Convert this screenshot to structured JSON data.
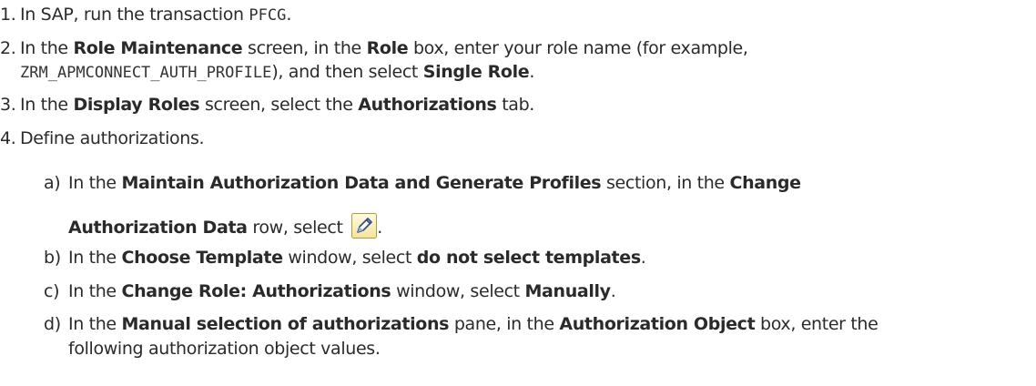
{
  "steps": [
    {
      "num": "1.",
      "parts": [
        {
          "t": "text",
          "v": "In SAP, run the transaction "
        },
        {
          "t": "code",
          "v": "PFCG"
        },
        {
          "t": "text",
          "v": "."
        }
      ]
    },
    {
      "num": "2.",
      "parts": [
        {
          "t": "text",
          "v": "In the "
        },
        {
          "t": "bold",
          "v": "Role Maintenance"
        },
        {
          "t": "text",
          "v": " screen, in the "
        },
        {
          "t": "bold",
          "v": "Role"
        },
        {
          "t": "text",
          "v": " box, enter your role name (for example,"
        }
      ],
      "cont": [
        {
          "t": "code",
          "v": "ZRM_APMCONNECT_AUTH_PROFILE"
        },
        {
          "t": "text",
          "v": "), and then select "
        },
        {
          "t": "bold",
          "v": "Single Role"
        },
        {
          "t": "text",
          "v": "."
        }
      ]
    },
    {
      "num": "3.",
      "parts": [
        {
          "t": "text",
          "v": "In the "
        },
        {
          "t": "bold",
          "v": "Display Roles"
        },
        {
          "t": "text",
          "v": " screen, select the "
        },
        {
          "t": "bold",
          "v": "Authorizations"
        },
        {
          "t": "text",
          "v": " tab."
        }
      ]
    },
    {
      "num": "4.",
      "parts": [
        {
          "t": "text",
          "v": "Define authorizations."
        }
      ]
    }
  ],
  "substeps": [
    {
      "letter": "a)",
      "parts": [
        {
          "t": "text",
          "v": "In the "
        },
        {
          "t": "bold",
          "v": "Maintain Authorization Data and Generate Profiles"
        },
        {
          "t": "text",
          "v": " section, in the "
        },
        {
          "t": "bold",
          "v": "Change"
        }
      ],
      "cont": [
        {
          "t": "bold",
          "v": "Authorization Data"
        },
        {
          "t": "text",
          "v": " row, select "
        },
        {
          "t": "icon",
          "v": "pencil-icon"
        },
        {
          "t": "text",
          "v": "."
        }
      ]
    },
    {
      "letter": "b)",
      "parts": [
        {
          "t": "text",
          "v": "In the "
        },
        {
          "t": "bold",
          "v": "Choose Template"
        },
        {
          "t": "text",
          "v": " window, select "
        },
        {
          "t": "bold",
          "v": "do not select templates"
        },
        {
          "t": "text",
          "v": "."
        }
      ]
    },
    {
      "letter": "c)",
      "parts": [
        {
          "t": "text",
          "v": "In the "
        },
        {
          "t": "bold",
          "v": "Change Role: Authorizations"
        },
        {
          "t": "text",
          "v": " window, select "
        },
        {
          "t": "bold",
          "v": "Manually"
        },
        {
          "t": "text",
          "v": "."
        }
      ]
    },
    {
      "letter": "d)",
      "parts": [
        {
          "t": "text",
          "v": "In the "
        },
        {
          "t": "bold",
          "v": "Manual selection of authorizations"
        },
        {
          "t": "text",
          "v": " pane, in the "
        },
        {
          "t": "bold",
          "v": "Authorization Object"
        },
        {
          "t": "text",
          "v": " box, enter the"
        }
      ],
      "cont": [
        {
          "t": "text",
          "v": "following authorization object values."
        }
      ]
    }
  ]
}
